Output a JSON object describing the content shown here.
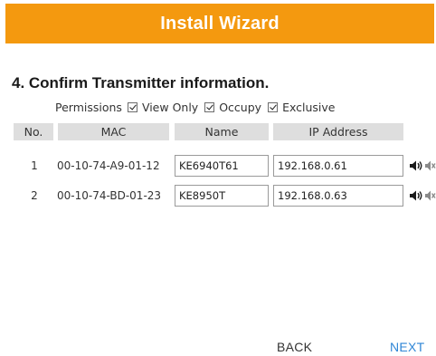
{
  "header": {
    "title": "Install Wizard",
    "color": "#f4990f"
  },
  "step": {
    "title": "4. Confirm Transmitter information."
  },
  "permissions": {
    "label": "Permissions",
    "options": [
      {
        "label": "View Only",
        "checked": true
      },
      {
        "label": "Occupy",
        "checked": true
      },
      {
        "label": "Exclusive",
        "checked": true
      }
    ]
  },
  "table": {
    "columns": [
      "No.",
      "MAC",
      "Name",
      "IP Address"
    ],
    "rows": [
      {
        "no": "1",
        "mac": "00-10-74-A9-01-12",
        "name": "KE6940T61",
        "ip": "192.168.0.61",
        "icons": [
          "speaker-on-icon",
          "speaker-mute-icon"
        ]
      },
      {
        "no": "2",
        "mac": "00-10-74-BD-01-23",
        "name": "KE8950T",
        "ip": "192.168.0.63",
        "icons": [
          "speaker-on-icon",
          "speaker-mute-icon"
        ]
      }
    ]
  },
  "footer": {
    "back_label": "BACK",
    "next_label": "NEXT",
    "next_color": "#2f86d6"
  }
}
